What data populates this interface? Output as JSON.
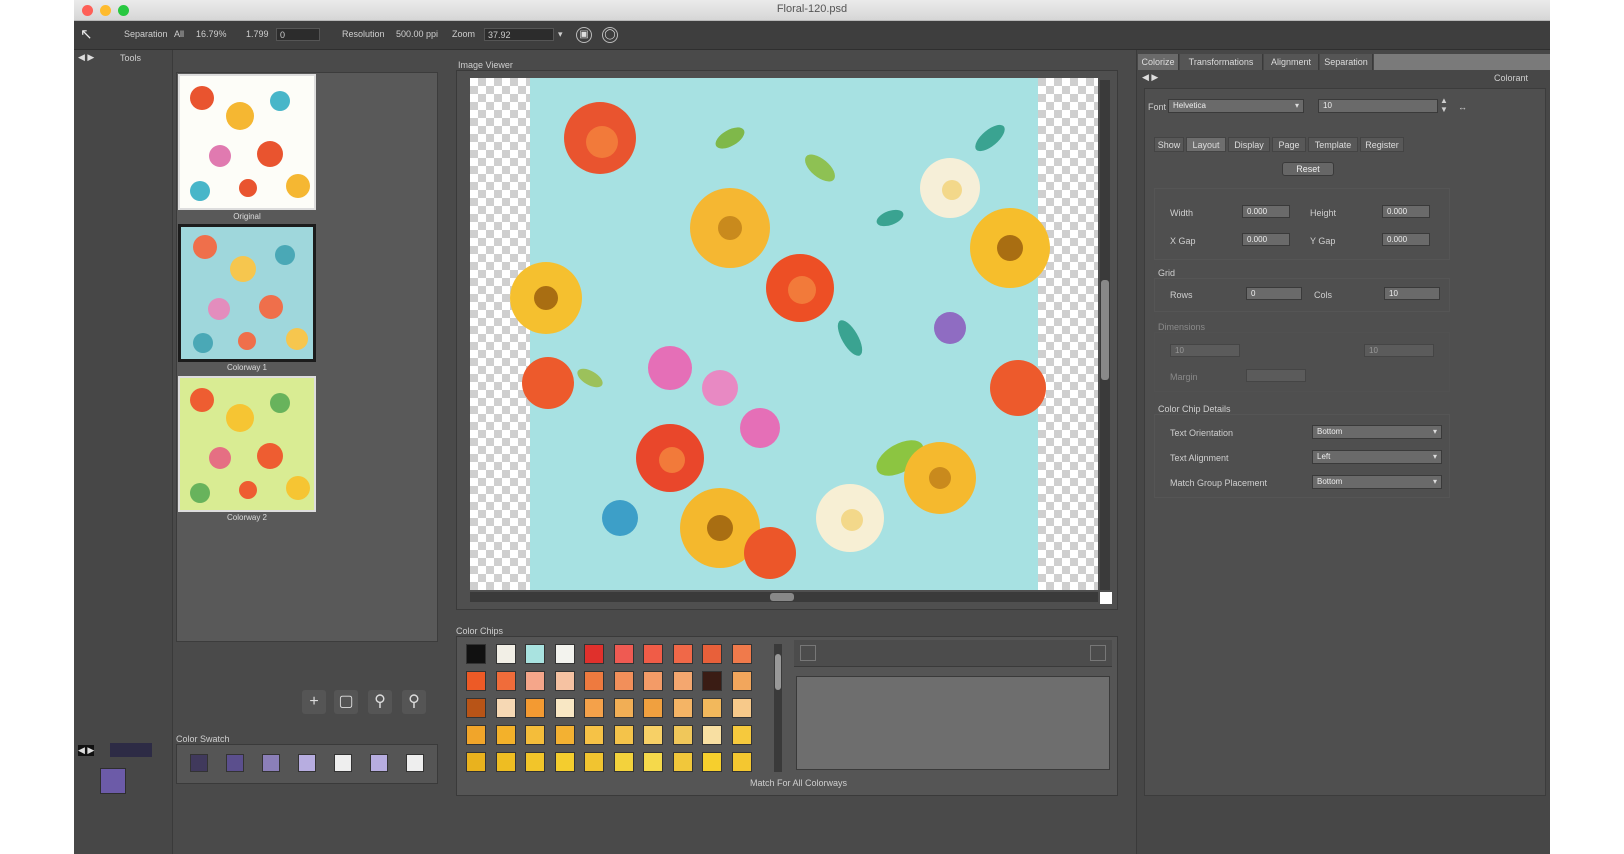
{
  "window": {
    "title": "Floral-120.psd",
    "traffic_lights": {
      "close": "#fe5f57",
      "minimize": "#febb2e",
      "zoom": "#28c840"
    }
  },
  "toolbar": {
    "separation_label": "Separation",
    "separation_value": "All",
    "pct_value": "16.79%",
    "value_a": "1.799",
    "value_b": "0",
    "resolution_label": "Resolution",
    "resolution_value": "500.00 ppi",
    "zoom_label": "Zoom",
    "zoom_value": "37.92"
  },
  "left_panel": {
    "header": "Tools",
    "thumbnails": [
      {
        "label": "Original",
        "colors": [
          "#fdfdf8",
          "#e9542f",
          "#f5b732",
          "#48b6c9",
          "#e07ab0"
        ]
      },
      {
        "label": "Colorway 1",
        "colors": [
          "#9fd7dc",
          "#ef6f4b",
          "#f6c64e",
          "#4aa8b6",
          "#e38dbd"
        ]
      },
      {
        "label": "Colorway 2",
        "colors": [
          "#d9ec93",
          "#ee5d31",
          "#f6c533",
          "#68b35c",
          "#e56f83"
        ]
      }
    ],
    "color_swatches_label": "Color Swatch",
    "swatches": [
      "#111111",
      "#2d2b45",
      "#40395c",
      "#5b4f8d",
      "#8b7fb8",
      "#b7ade0",
      "#eeeeee"
    ],
    "current_color": "#6c5ba8"
  },
  "preview": {
    "label": "Image Viewer",
    "background": "#a7e1e2"
  },
  "color_chips": {
    "label": "Color Chips",
    "footer": "Match For All Colorways",
    "grid": [
      [
        "#111111",
        "#f2efe6",
        "#a9e3e0",
        "#f3f3ee",
        "#e0302c",
        "#ef5a52",
        "#f05c47",
        "#f06848",
        "#e8603a",
        "#f07a4b"
      ],
      [
        "#ed5a26",
        "#f06c3a",
        "#f5a68a",
        "#f6c2a2",
        "#ee7a3f",
        "#f28f5a",
        "#f39b67",
        "#f4a76f",
        "#3a1c14",
        "#f2a65c"
      ],
      [
        "#b85417",
        "#f6d8b4",
        "#f39a32",
        "#f8e7c4",
        "#f4a14a",
        "#f1ae55",
        "#f0a03f",
        "#f4b465",
        "#f2b85c",
        "#f7c98a"
      ],
      [
        "#f1a52a",
        "#f3b12a",
        "#f4bd3a",
        "#f3b132",
        "#f6c246",
        "#f4c34a",
        "#f7d066",
        "#f0c75a",
        "#f8dfa2",
        "#f6c93d"
      ],
      [
        "#e9b21e",
        "#eebd22",
        "#f2c52a",
        "#f4cd2e",
        "#f1c430",
        "#f3d23c",
        "#f5d94b",
        "#f1c73b",
        "#f6cf2d",
        "#f4c730"
      ]
    ]
  },
  "right_panel": {
    "tabs": [
      "Colorize",
      "Transformations",
      "Alignment",
      "Separation"
    ],
    "subheader": "Colorant",
    "font_label": "Font",
    "font_value": "Helvetica",
    "size_value": "10",
    "sub_tabs": [
      "Show",
      "Layout",
      "Display",
      "Page",
      "Template",
      "Register"
    ],
    "reset_button": "Reset",
    "width_label": "Width",
    "width_value": "0.000",
    "height_label": "Height",
    "height_value": "0.000",
    "x_gap_label": "X Gap",
    "x_gap_value": "0.000",
    "y_gap_label": "Y Gap",
    "y_gap_value": "0.000",
    "grid_label": "Grid",
    "rows_label": "Rows",
    "rows_value": "0",
    "cols_label": "Cols",
    "cols_value": "10",
    "dimensions_label": "Dimensions",
    "dim_value_a": "10",
    "dim_value_b": "10",
    "margin_label": "Margin",
    "color_chip_details_label": "Color Chip Details",
    "text_orientation_label": "Text Orientation",
    "text_orientation_value": "Bottom",
    "text_alignment_label": "Text Alignment",
    "text_alignment_value": "Left",
    "match_group_placement_label": "Match Group Placement",
    "match_group_placement_value": "Bottom"
  }
}
